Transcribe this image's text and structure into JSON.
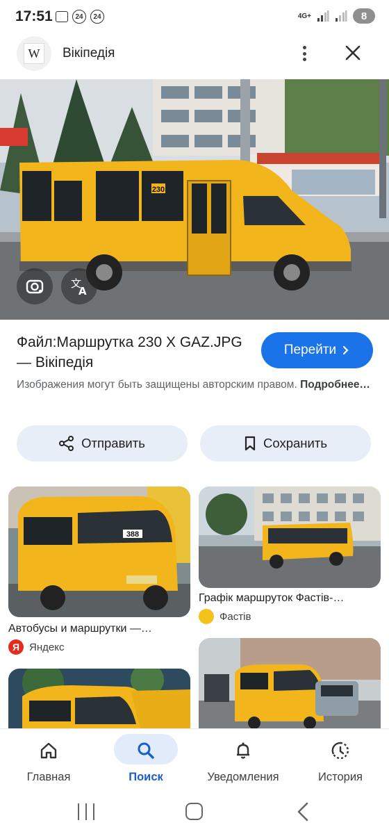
{
  "status_bar": {
    "time": "17:51",
    "badge_1": "24",
    "badge_2": "24",
    "network": "4G+",
    "battery": "8"
  },
  "header": {
    "logo_letter": "W",
    "site_name": "Вікіпедія"
  },
  "hero": {
    "route_number": "230"
  },
  "result": {
    "title": "Файл:Маршрутка 230 Х GAZ.JPG — Вікіпедія",
    "go_button_label": "Перейти",
    "copyright_text": "Изображения могут быть защищены авторским правом.",
    "more_link": "Подробнее…"
  },
  "actions": {
    "share_label": "Отправить",
    "save_label": "Сохранить"
  },
  "grid": [
    {
      "caption": "Автобусы и маршрутки —…",
      "source": "Яндекс",
      "source_icon": "Я",
      "plate_number": "388"
    },
    {
      "caption": "Графік маршруток Фастів-…",
      "source": "Фастів",
      "source_icon": ""
    }
  ],
  "bottom_nav": {
    "items": [
      {
        "label": "Главная",
        "icon": "home-icon"
      },
      {
        "label": "Поиск",
        "icon": "search-icon",
        "active": true
      },
      {
        "label": "Уведомления",
        "icon": "bell-icon"
      },
      {
        "label": "История",
        "icon": "history-icon"
      }
    ]
  },
  "colors": {
    "accent": "#1a73e8",
    "bus_yellow": "#f2b51b",
    "pill_bg": "#e8eef7"
  }
}
